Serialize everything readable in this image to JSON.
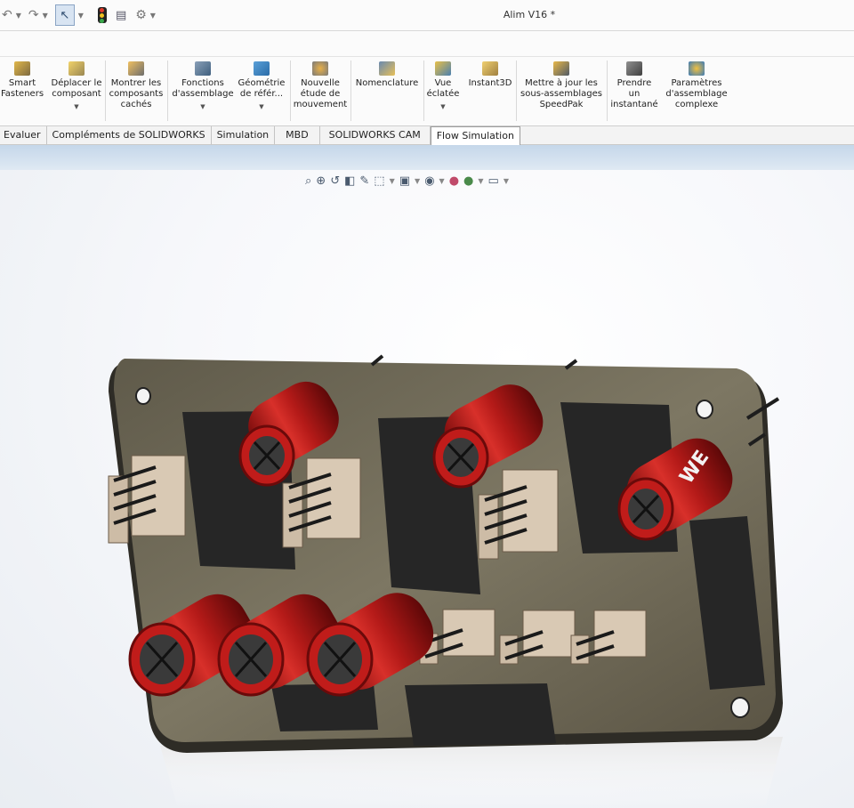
{
  "window": {
    "title": "Alim V16 *"
  },
  "quick_access": {
    "undo_icon": "undo-icon",
    "redo_icon": "redo-icon",
    "select_icon": "select-arrow-icon",
    "rebuild_icon": "traffic-light-icon",
    "file_props_icon": "file-properties-icon",
    "options_icon": "gear-icon"
  },
  "ribbon": {
    "buttons": [
      {
        "label": "Smart\nFasteners",
        "icon": "smart-fasteners-icon"
      },
      {
        "label": "Déplacer le\ncomposant",
        "icon": "move-component-icon"
      },
      {
        "label": "Montrer les\ncomposants\ncachés",
        "icon": "show-hidden-icon"
      },
      {
        "label": "Fonctions\nd'assemblage",
        "icon": "assembly-features-icon"
      },
      {
        "label": "Géométrie\nde référ...",
        "icon": "reference-geometry-icon"
      },
      {
        "label": "Nouvelle\nétude de\nmouvement",
        "icon": "motion-study-icon"
      },
      {
        "label": "Nomenclature",
        "icon": "bom-icon"
      },
      {
        "label": "Vue\néclatée",
        "icon": "exploded-view-icon"
      },
      {
        "label": "Instant3D",
        "icon": "instant3d-icon"
      },
      {
        "label": "Mettre à jour les\nsous-assemblages\nSpeedPak",
        "icon": "speedpak-icon"
      },
      {
        "label": "Prendre\nun\ninstantané",
        "icon": "camera-icon"
      },
      {
        "label": "Paramètres\nd'assemblage\ncomplexe",
        "icon": "large-assembly-icon"
      }
    ]
  },
  "tabs": [
    "Evaluer",
    "Compléments de SOLIDWORKS",
    "Simulation",
    "MBD",
    "SOLIDWORKS CAM",
    "Flow Simulation"
  ],
  "active_tab": "Flow Simulation",
  "heads_up_toolbar": {
    "icons": [
      "zoom-to-fit-icon",
      "zoom-area-icon",
      "previous-view-icon",
      "section-view-icon",
      "dynamic-annotation-icon",
      "view-orientation-icon",
      "display-style-icon",
      "hide-show-icon",
      "edit-appearance-icon",
      "apply-scene-icon",
      "view-settings-icon"
    ]
  },
  "model": {
    "capacitor_brand": "WE",
    "colors": {
      "pcb": "#7a735f",
      "pad": "#2b2b2b",
      "capacitor": "#b41a18",
      "connector": "#d9c9b4"
    }
  }
}
